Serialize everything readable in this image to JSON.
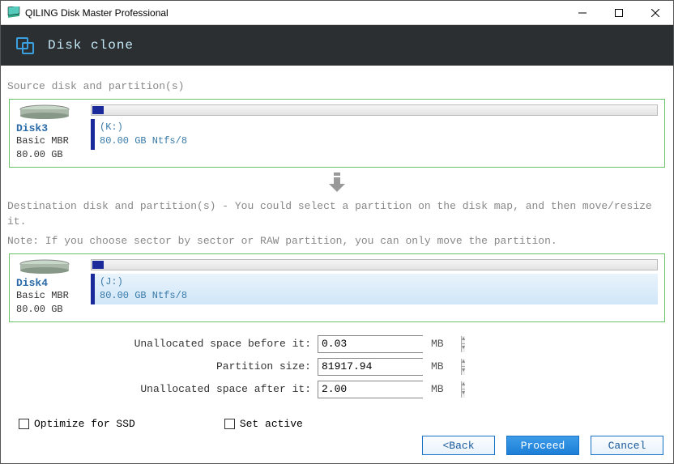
{
  "window": {
    "title": "QILING Disk Master Professional"
  },
  "header": {
    "heading": "Disk clone"
  },
  "source": {
    "section_label": "Source disk and partition(s)",
    "disk": {
      "name": "Disk3",
      "type": "Basic MBR",
      "size": "80.00 GB",
      "part_letter": "(K:)",
      "part_info": "80.00 GB Ntfs/8"
    }
  },
  "dest": {
    "section_label": "Destination disk and partition(s) - You could select a partition on the disk map, and then move/resize it.",
    "note": "Note: If you choose sector by sector or RAW partition, you can only move the partition.",
    "disk": {
      "name": "Disk4",
      "type": "Basic MBR",
      "size": "80.00 GB",
      "part_letter": "(J:)",
      "part_info": "80.00 GB Ntfs/8"
    }
  },
  "form": {
    "before_label": "Unallocated space before it:",
    "before_value": "0.03",
    "size_label": "Partition size:",
    "size_value": "81917.94",
    "after_label": "Unallocated space after it:",
    "after_value": "2.00",
    "unit": "MB"
  },
  "options": {
    "ssd": "Optimize for SSD",
    "active": "Set active"
  },
  "buttons": {
    "back": "<Back",
    "proceed": "Proceed",
    "cancel": "Cancel"
  }
}
